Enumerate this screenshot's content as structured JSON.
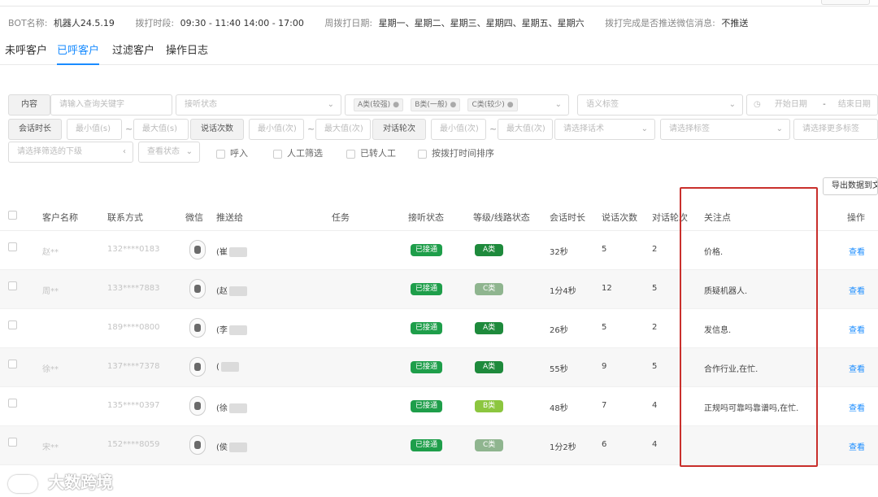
{
  "info": {
    "bot_name_label": "BOT名称:",
    "bot_name": "机器人24.5.19",
    "call_time_label": "拨打时段:",
    "call_time": "09:30 - 11:40 14:00 - 17:00",
    "weekday_label": "周拨打日期:",
    "weekdays": "星期一、星期二、星期三、星期四、星期五、星期六",
    "push_label": "拨打完成是否推送微信消息:",
    "push_value": "不推送"
  },
  "tabs": [
    {
      "label": "未呼客户"
    },
    {
      "label": "已呼客户"
    },
    {
      "label": "过滤客户"
    },
    {
      "label": "操作日志"
    }
  ],
  "filters": {
    "content_label": "内容",
    "keyword_placeholder": "请输入查询关键字",
    "answer_status_placeholder": "接听状态",
    "grade_tags": [
      "A类(较强)",
      "B类(一般)",
      "C类(较少)"
    ],
    "semantic_tag_placeholder": "语义标签",
    "start_date": "开始日期",
    "date_sep": "-",
    "end_date": "结束日期",
    "duration_label": "会话时长",
    "min_placeholder": "最小值(s)",
    "max_placeholder": "最大值(s)",
    "talk_count_label": "说话次数",
    "min_count": "最小值(次)",
    "max_count": "最大值(次)",
    "rounds_label": "对话轮次",
    "min_rounds": "最小值(次)",
    "max_rounds": "最大值(次)",
    "script_placeholder": "请选择话术",
    "tag_placeholder": "请选择标签",
    "more_tags_placeholder": "请选择更多标签",
    "sub_placeholder": "请选择筛选的下级",
    "view_status_placeholder": "查看状态",
    "check_incoming": "呼入",
    "check_manual": "人工筛选",
    "check_transferred": "已转人工",
    "check_sort": "按拨打时间排序"
  },
  "export_label": "导出数据到文件",
  "columns": [
    "客户名称",
    "联系方式",
    "微信",
    "推送给",
    "任务",
    "接听状态",
    "等级/线路状态",
    "会话时长",
    "说话次数",
    "对话轮次",
    "关注点",
    "操作"
  ],
  "rows": [
    {
      "name": "赵**",
      "phone": "132****0183",
      "push_to": "(崔",
      "status": "已接通",
      "grade": "A类",
      "grade_color": "#1e8a3c",
      "duration": "32秒",
      "talks": "5",
      "rounds": "2",
      "focus": "价格.",
      "action": "查看"
    },
    {
      "name": "周**",
      "phone": "133****7883",
      "push_to": "(赵",
      "status": "已接通",
      "grade": "C类",
      "grade_color": "#8fb58f",
      "duration": "1分4秒",
      "talks": "12",
      "rounds": "5",
      "focus": "质疑机器人.",
      "action": "查看"
    },
    {
      "name": "",
      "phone": "189****0800",
      "push_to": "(李",
      "status": "已接通",
      "grade": "A类",
      "grade_color": "#1e8a3c",
      "duration": "26秒",
      "talks": "5",
      "rounds": "2",
      "focus": "发信息.",
      "action": "查看"
    },
    {
      "name": "徐**",
      "phone": "137****7378",
      "push_to": "(",
      "status": "已接通",
      "grade": "A类",
      "grade_color": "#1e8a3c",
      "duration": "55秒",
      "talks": "9",
      "rounds": "5",
      "focus": "合作行业,在忙.",
      "action": "查看"
    },
    {
      "name": "",
      "phone": "135****0397",
      "push_to": "(徐",
      "status": "已接通",
      "grade": "B类",
      "grade_color": "#8cc63f",
      "duration": "48秒",
      "talks": "7",
      "rounds": "4",
      "focus": "正规吗可靠吗靠谱吗,在忙.",
      "action": "查看"
    },
    {
      "name": "宋**",
      "phone": "152****8059",
      "push_to": "(侯",
      "status": "已接通",
      "grade": "C类",
      "grade_color": "#8fb58f",
      "duration": "1分2秒",
      "talks": "6",
      "rounds": "4",
      "focus": "",
      "action": "查看"
    }
  ],
  "watermark": "大数跨境",
  "colors": {
    "accent": "#1a8cff",
    "connected": "#1e9e4a",
    "highlight_border": "#c9302c"
  }
}
